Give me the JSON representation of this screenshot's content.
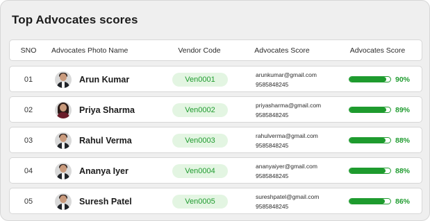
{
  "title": "Top Advocates scores",
  "headers": {
    "sno": "SNO",
    "photo_name": "Advocates Photo Name",
    "vendor_code": "Vendor Code",
    "advocates_score_1": "Advocates Score",
    "advocates_score_2": "Advocates Score"
  },
  "colors": {
    "accent_green": "#1e9b2e",
    "pill_bg": "#e3f5e2"
  },
  "rows": [
    {
      "sno": "01",
      "name": "Arun Kumar",
      "vendor": "Ven0001",
      "email": "arunkumar@gmail.com",
      "phone": "9585848245",
      "score": 0.9,
      "score_label": "90%",
      "avatar": "male-avatar-icon"
    },
    {
      "sno": "02",
      "name": "Priya Sharma",
      "vendor": "Ven0002",
      "email": "priyasharma@gmail.com",
      "phone": "9585848245",
      "score": 0.89,
      "score_label": "89%",
      "avatar": "female-avatar-icon"
    },
    {
      "sno": "03",
      "name": "Rahul Verma",
      "vendor": "Ven0003",
      "email": "rahulverma@gmail.com",
      "phone": "9585848245",
      "score": 0.88,
      "score_label": "88%",
      "avatar": "male-avatar-icon"
    },
    {
      "sno": "04",
      "name": "Ananya Iyer",
      "vendor": "Ven0004",
      "email": "ananyaiyer@gmail.com",
      "phone": "9585848245",
      "score": 0.88,
      "score_label": "88%",
      "avatar": "male-avatar-icon"
    },
    {
      "sno": "05",
      "name": "Suresh Patel",
      "vendor": "Ven0005",
      "email": "sureshpatel@gmail.com",
      "phone": "9585848245",
      "score": 0.86,
      "score_label": "86%",
      "avatar": "male-avatar-icon"
    }
  ]
}
